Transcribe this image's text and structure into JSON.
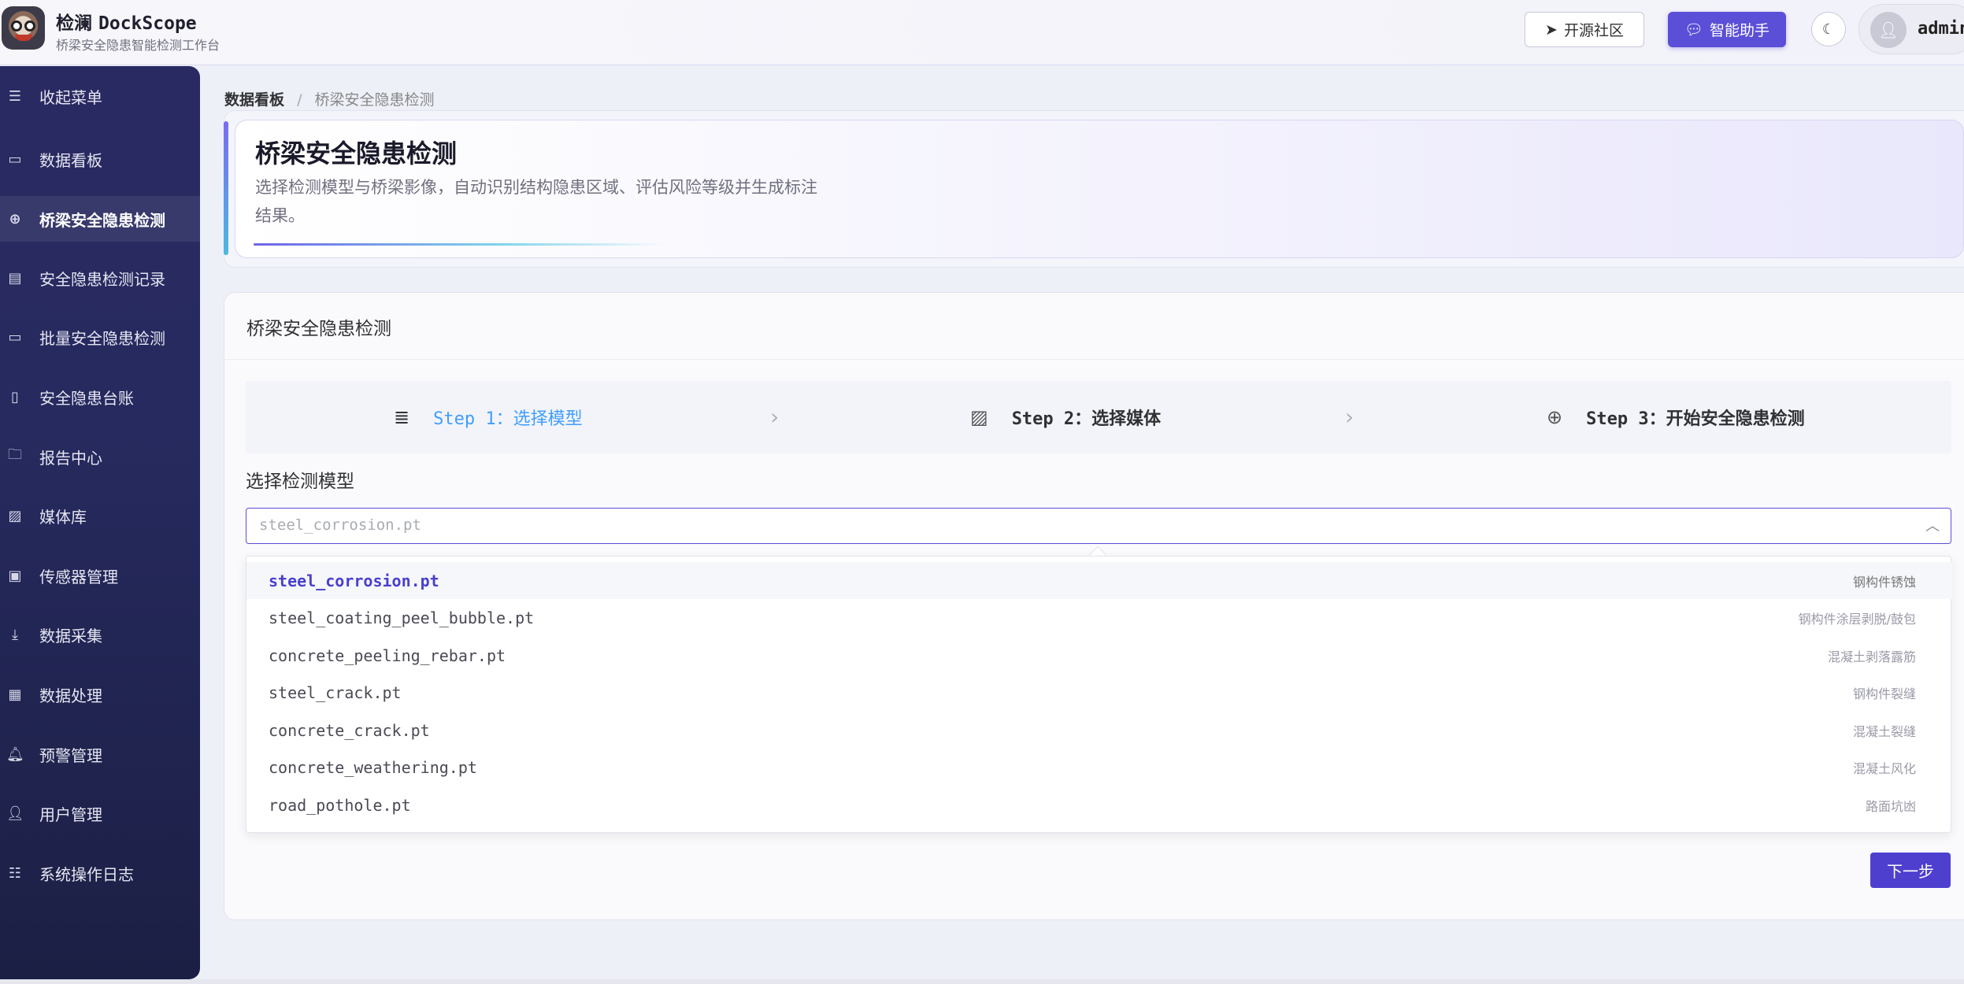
{
  "header": {
    "brand_cn": "检澜",
    "brand_en": "DockScope",
    "subtitle": "桥梁安全隐患智能检测工作台",
    "community_label": "开源社区",
    "assistant_label": "智能助手",
    "user_name": "admin"
  },
  "sidebar": {
    "collapse_label": "收起菜单",
    "items": [
      {
        "label": "数据看板",
        "icon": "presentation-board-icon"
      },
      {
        "label": "桥梁安全隐患检测",
        "icon": "crosshair-icon"
      },
      {
        "label": "安全隐患检测记录",
        "icon": "clipboard-icon"
      },
      {
        "label": "批量安全隐患检测",
        "icon": "stack-icon"
      },
      {
        "label": "安全隐患台账",
        "icon": "ledger-book-icon"
      },
      {
        "label": "报告中心",
        "icon": "folder-icon"
      },
      {
        "label": "媒体库",
        "icon": "image-icon"
      },
      {
        "label": "传感器管理",
        "icon": "chip-icon"
      },
      {
        "label": "数据采集",
        "icon": "download-icon"
      },
      {
        "label": "数据处理",
        "icon": "data-chart-icon"
      },
      {
        "label": "预警管理",
        "icon": "bell-icon"
      },
      {
        "label": "用户管理",
        "icon": "user-icon"
      },
      {
        "label": "系统操作日志",
        "icon": "sliders-icon"
      }
    ],
    "active_index": 1
  },
  "breadcrumb": {
    "root": "数据看板",
    "separator": "/",
    "current": "桥梁安全隐患检测"
  },
  "hero": {
    "title": "桥梁安全隐患检测",
    "description": "选择检测模型与桥梁影像，自动识别结构隐患区域、评估风险等级并生成标注结果。"
  },
  "card": {
    "title": "桥梁安全隐患检测",
    "steps": [
      {
        "label": "Step 1：选择模型",
        "icon": "database-icon",
        "active": true
      },
      {
        "label": "Step 2：选择媒体",
        "icon": "image-icon",
        "active": false
      },
      {
        "label": "Step 3：开始安全隐患检测",
        "icon": "crosshair-icon",
        "active": false
      }
    ],
    "field_label": "选择检测模型",
    "select_placeholder": "steel_corrosion.pt",
    "options": [
      {
        "name": "steel_corrosion.pt",
        "desc": "钢构件锈蚀",
        "selected": true
      },
      {
        "name": "steel_coating_peel_bubble.pt",
        "desc": "钢构件涂层剥脱/鼓包",
        "selected": false
      },
      {
        "name": "concrete_peeling_rebar.pt",
        "desc": "混凝土剥落露筋",
        "selected": false
      },
      {
        "name": "steel_crack.pt",
        "desc": "钢构件裂缝",
        "selected": false
      },
      {
        "name": "concrete_crack.pt",
        "desc": "混凝土裂缝",
        "selected": false
      },
      {
        "name": "concrete_weathering.pt",
        "desc": "混凝土风化",
        "selected": false
      },
      {
        "name": "road_pothole.pt",
        "desc": "路面坑凼",
        "selected": false
      }
    ],
    "next_label": "下一步"
  },
  "colors": {
    "accent": "#5b4fd8",
    "step_active": "#409eff",
    "sidebar_bg": "#262a5e"
  }
}
